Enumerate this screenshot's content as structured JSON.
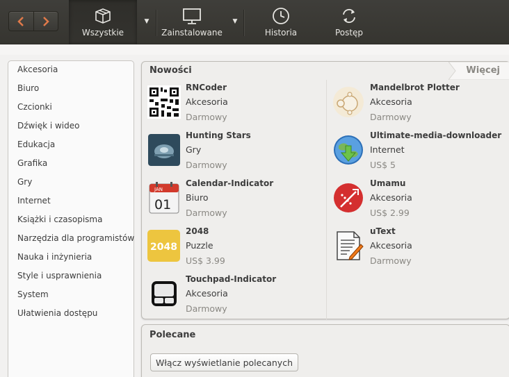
{
  "toolbar": {
    "all_label": "Wszystkie",
    "installed_label": "Zainstalowane",
    "history_label": "Historia",
    "progress_label": "Postęp"
  },
  "sidebar": {
    "items": [
      {
        "label": "Akcesoria"
      },
      {
        "label": "Biuro"
      },
      {
        "label": "Czcionki"
      },
      {
        "label": "Dźwięk i wideo"
      },
      {
        "label": "Edukacja"
      },
      {
        "label": "Grafika"
      },
      {
        "label": "Gry"
      },
      {
        "label": "Internet"
      },
      {
        "label": "Książki i czasopisma"
      },
      {
        "label": "Narzędzia dla programistów"
      },
      {
        "label": "Nauka i inżynieria"
      },
      {
        "label": "Style i usprawnienia"
      },
      {
        "label": "System"
      },
      {
        "label": "Ułatwienia dostępu"
      }
    ]
  },
  "whats_new": {
    "title": "Nowości",
    "more_label": "Więcej",
    "apps": [
      {
        "name": "RNCoder",
        "category": "Akcesoria",
        "price": "Darmowy",
        "icon": "qr-code-icon"
      },
      {
        "name": "Mandelbrot Plotter",
        "category": "Akcesoria",
        "price": "Darmowy",
        "icon": "mandelbrot-icon"
      },
      {
        "name": "Hunting Stars",
        "category": "Gry",
        "price": "Darmowy",
        "icon": "spaceship-icon"
      },
      {
        "name": "Ultimate-media-downloader",
        "category": "Internet",
        "price": "US$ 5",
        "icon": "globe-download-icon"
      },
      {
        "name": "Calendar-Indicator",
        "category": "Biuro",
        "price": "Darmowy",
        "icon": "calendar-icon"
      },
      {
        "name": "Umamu",
        "category": "Akcesoria",
        "price": "US$ 2.99",
        "icon": "umamu-icon"
      },
      {
        "name": "2048",
        "category": "Puzzle",
        "price": "US$ 3.99",
        "icon": "tile-2048-icon"
      },
      {
        "name": "uText",
        "category": "Akcesoria",
        "price": "Darmowy",
        "icon": "text-editor-icon"
      },
      {
        "name": "Touchpad-Indicator",
        "category": "Akcesoria",
        "price": "Darmowy",
        "icon": "touchpad-icon"
      }
    ],
    "calendar_month": "JAN",
    "calendar_day": "01",
    "tile_text": "2048"
  },
  "recommended": {
    "title": "Polecane",
    "button_label": "Włącz wyświetlanie polecanych"
  },
  "colors": {
    "toolbar_bg": "#3a3935",
    "accent_orange": "#dd4814"
  }
}
